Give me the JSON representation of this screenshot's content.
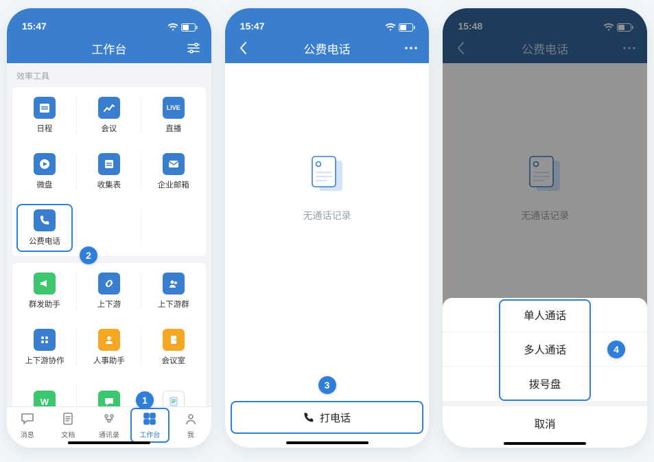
{
  "colors": {
    "primary": "#3a7fcf",
    "badge": "#2f7ed8",
    "green": "#3cc76f",
    "orange": "#f5a623"
  },
  "status": {
    "time_a": "15:47",
    "time_b": "15:48"
  },
  "screen1": {
    "title": "工作台",
    "section_label": "效率工具",
    "grid1": [
      {
        "label": "日程",
        "icon": "calendar-icon",
        "bg": "#3a7fcf"
      },
      {
        "label": "会议",
        "icon": "chart-icon",
        "bg": "#3a7fcf"
      },
      {
        "label": "直播",
        "icon": "live-icon",
        "bg": "#3a7fcf",
        "text": "LIVE"
      },
      {
        "label": "微盘",
        "icon": "play-icon",
        "bg": "#3a7fcf"
      },
      {
        "label": "收集表",
        "icon": "folder-icon",
        "bg": "#3a7fcf"
      },
      {
        "label": "企业邮箱",
        "icon": "mail-icon",
        "bg": "#3a7fcf"
      },
      {
        "label": "公费电话",
        "icon": "phone-icon",
        "bg": "#3a7fcf",
        "highlight": true
      }
    ],
    "grid2": [
      {
        "label": "群发助手",
        "icon": "announce-icon",
        "bg": "#3cc76f"
      },
      {
        "label": "上下游",
        "icon": "link-icon",
        "bg": "#3a7fcf"
      },
      {
        "label": "上下游群",
        "icon": "group-icon",
        "bg": "#3a7fcf"
      },
      {
        "label": "上下游协作",
        "icon": "dots-icon",
        "bg": "#3a7fcf"
      },
      {
        "label": "人事助手",
        "icon": "person-icon",
        "bg": "#f5a623"
      },
      {
        "label": "会议室",
        "icon": "door-icon",
        "bg": "#f5a623"
      },
      {
        "label": "",
        "icon": "wps-icon",
        "bg": "#3cc76f"
      },
      {
        "label": "",
        "icon": "chat-icon",
        "bg": "#3cc76f"
      },
      {
        "label": "",
        "icon": "doc-icon",
        "bg": "#ffffff"
      }
    ],
    "tabs": [
      {
        "label": "消息",
        "icon": "tab-chat-icon"
      },
      {
        "label": "文档",
        "icon": "tab-doc-icon"
      },
      {
        "label": "通讯录",
        "icon": "tab-contacts-icon"
      },
      {
        "label": "工作台",
        "icon": "tab-grid-icon",
        "active": true,
        "highlight": true
      },
      {
        "label": "我",
        "icon": "tab-me-icon"
      }
    ],
    "badges": {
      "tab": "1",
      "phone_app": "2"
    }
  },
  "screen2": {
    "title": "公费电话",
    "empty_text": "无通话记录",
    "call_button": "打电话",
    "badge": "3"
  },
  "screen3": {
    "title": "公费电话",
    "empty_text": "无通话记录",
    "sheet_options": [
      "单人通话",
      "多人通话",
      "拨号盘"
    ],
    "cancel": "取消",
    "badge": "4"
  }
}
